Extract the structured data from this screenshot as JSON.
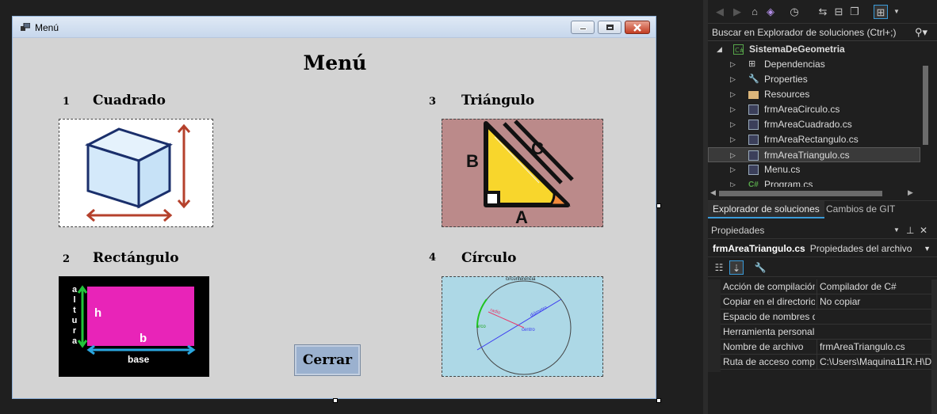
{
  "window": {
    "title": "Menú",
    "buttons": [
      "minimize",
      "maximize",
      "close"
    ]
  },
  "form": {
    "title": "Menú",
    "items": [
      {
        "number": "1",
        "label": "Cuadrado",
        "image": "cube-icon"
      },
      {
        "number": "2",
        "label": "Rectángulo",
        "image": "rectangle-diagram"
      },
      {
        "number": "3",
        "label": "Triángulo",
        "image": "right-triangle-icon"
      },
      {
        "number": "4",
        "label": "Círculo",
        "image": "circle-diagram"
      }
    ],
    "close_button": "Cerrar",
    "rect_diagram": {
      "altura": [
        "a",
        "l",
        "t",
        "u",
        "r",
        "a"
      ],
      "h": "h",
      "b": "b",
      "base": "base"
    },
    "tri_diagram": {
      "a": "A",
      "b": "B",
      "c": "C"
    },
    "circle_diagram": {
      "circunferencia": "circunferencia",
      "radio": "radio",
      "diametro": "diámetro",
      "centro": "centro",
      "arco": "arco"
    }
  },
  "solution_explorer": {
    "search_placeholder": "Buscar en Explorador de soluciones (Ctrl+;)",
    "project": "SistemaDeGeometria",
    "items": [
      {
        "label": "Dependencias",
        "icon": "dependencies-icon"
      },
      {
        "label": "Properties",
        "icon": "wrench-icon"
      },
      {
        "label": "Resources",
        "icon": "folder-icon"
      },
      {
        "label": "frmAreaCirculo.cs",
        "icon": "form-icon"
      },
      {
        "label": "frmAreaCuadrado.cs",
        "icon": "form-icon"
      },
      {
        "label": "frmAreaRectangulo.cs",
        "icon": "form-icon"
      },
      {
        "label": "frmAreaTriangulo.cs",
        "icon": "form-icon",
        "selected": true
      },
      {
        "label": "Menu.cs",
        "icon": "form-icon"
      },
      {
        "label": "Program.cs",
        "icon": "csharp-icon"
      }
    ],
    "tabs": [
      "Explorador de soluciones",
      "Cambios de GIT"
    ]
  },
  "properties": {
    "header": "Propiedades",
    "object_name": "frmAreaTriangulo.cs",
    "object_type": "Propiedades del archivo",
    "rows": [
      {
        "name": "Acción de compilación",
        "value": "Compilador de C#"
      },
      {
        "name": "Copiar en el directorio",
        "value": "No copiar"
      },
      {
        "name": "Espacio de nombres d",
        "value": ""
      },
      {
        "name": "Herramienta personali",
        "value": ""
      },
      {
        "name": "Nombre de archivo",
        "value": "frmAreaTriangulo.cs"
      },
      {
        "name": "Ruta de acceso compl",
        "value": "C:\\Users\\Maquina11R.H\\D"
      }
    ]
  },
  "colors": {
    "accent": "#3a9bd9",
    "form_bg": "#d3d3d3",
    "ide_bg": "#1f1f1f",
    "close_btn": "#9bb1cf"
  }
}
